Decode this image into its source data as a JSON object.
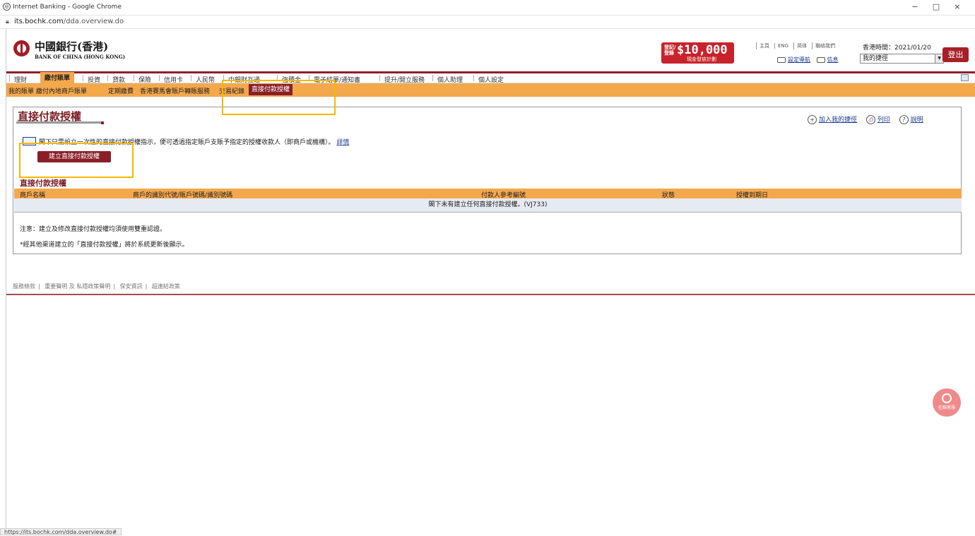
{
  "browser": {
    "window_title": "Internet Banking - Google Chrome",
    "url_host": "its.bochk.com",
    "url_path": "/dda.overview.do",
    "status_url": "https://its.bochk.com/dda.overview.do#",
    "minimize": "−",
    "maximize": "□",
    "close": "×"
  },
  "header": {
    "bank_name_cn": "中國銀行(香港)",
    "bank_name_en": "BANK OF CHINA (HONG KONG)",
    "promo_line1": "登記/",
    "promo_line2": "登錄",
    "promo_amount": "$10,000",
    "promo_caption": "現金發放計劃",
    "top_links": [
      "主頁",
      "ENG",
      "简体",
      "聯絡我們"
    ],
    "hk_time": "香港時間：2021/01/20",
    "quick_links": [
      "設定導航",
      "信息"
    ],
    "my_route": "我的捷徑",
    "logout": "登出"
  },
  "nav": {
    "items": [
      "理財",
      "繳付賬單",
      "投資",
      "貸款",
      "保險",
      "信用卡",
      "人民幣",
      "中銀財互通",
      "強積金",
      "電子結單/通知書",
      "提升/開立服務",
      "個人助理",
      "個人設定"
    ],
    "active_index": 1
  },
  "subnav": {
    "items": [
      "我的賬單",
      "繳付內地商戶賬單",
      "定期繳費",
      "香港賽馬會賬戶轉賬服務",
      "交易紀錄",
      "直接付款授權"
    ],
    "active_index": 5
  },
  "content": {
    "page_title": "直接付款授權",
    "tools": [
      "加入我的捷徑",
      "列印",
      "說明"
    ],
    "intro_text": "閣下只需設立一次性的直接付款授權指示，便可透過指定賬戶支賬予指定的授權收款人（即商戶或機構）。",
    "details_link": "詳情",
    "create_button": "建立直接付款授權",
    "section_title": "直接付款授權",
    "table_headers": [
      "商戶名稱",
      "商戶的識別代號/賬戶號碼/識別號碼",
      "付款人參考編號",
      "狀態",
      "授權到期日"
    ],
    "empty_message": "閣下未有建立任何直接付款授權。(VJ733)",
    "note1": "注意：建立及修改直接付款授權均須使用雙重認證。",
    "note2": "*經其他渠道建立的「直接付款授權」將於系統更新後顯示。"
  },
  "footer": {
    "links": [
      "服務條款",
      "重要聲明 及 私隱政策聲明",
      "保安資訊",
      "超連結政策"
    ],
    "separator": "|"
  },
  "chat": {
    "label": "在線客服"
  },
  "colors": {
    "brand_red": "#8a1f28",
    "nav_orange": "#f4a84c",
    "link_blue": "#1b3d8f",
    "highlight_yellow": "#f5b800"
  }
}
